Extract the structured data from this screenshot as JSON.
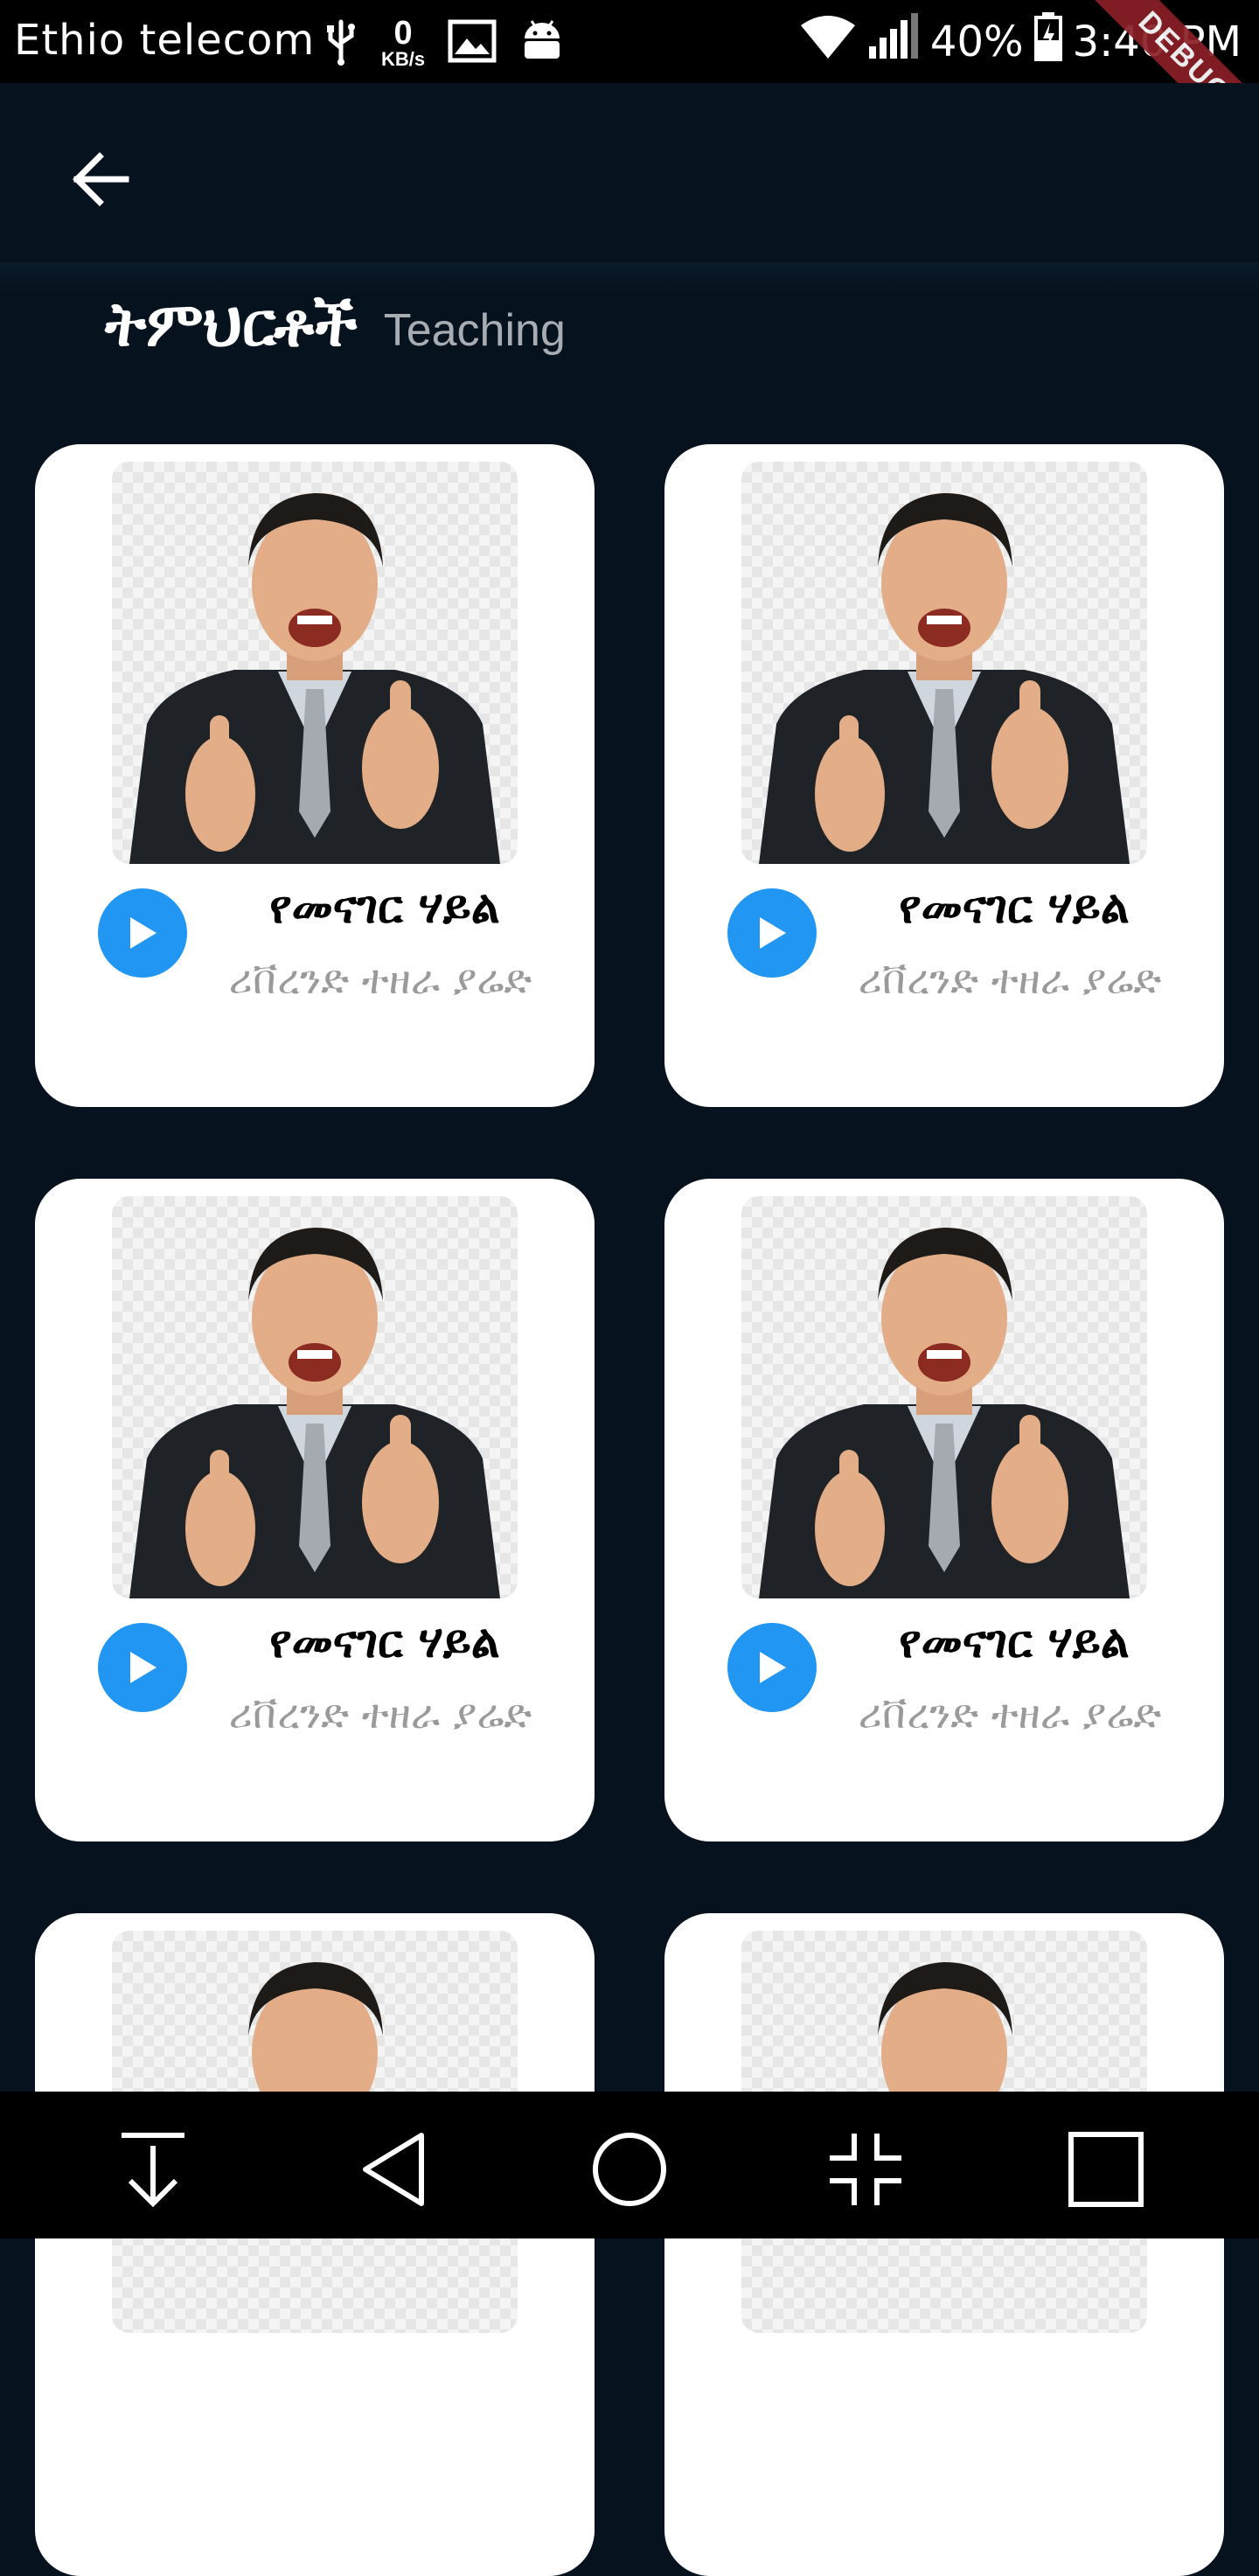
{
  "status_bar": {
    "carrier": "Ethio telecom",
    "kb_value": "0",
    "kb_unit": "KB/s",
    "battery": "40%",
    "time": "3:40 PM",
    "debug_label": "DEBUG"
  },
  "header": {
    "title_amharic": "ትምህርቶች",
    "title_english": "Teaching"
  },
  "cards": [
    {
      "title": "የመናገር ሃይል",
      "subtitle": "ሪቨረንድ ተዘራ ያሬድ"
    },
    {
      "title": "የመናገር ሃይል",
      "subtitle": "ሪቨረንድ ተዘራ ያሬድ"
    },
    {
      "title": "የመናገር ሃይል",
      "subtitle": "ሪቨረንድ ተዘራ ያሬድ"
    },
    {
      "title": "የመናገር ሃይል",
      "subtitle": "ሪቨረንድ ተዘራ ያሬድ"
    },
    {
      "title": "",
      "subtitle": ""
    },
    {
      "title": "",
      "subtitle": ""
    }
  ],
  "colors": {
    "background": "#06121d",
    "card": "#ffffff",
    "play_button": "#2196f3",
    "debug_ribbon": "#8b1f27"
  },
  "icons": {
    "back": "arrow-left-icon",
    "play": "play-icon",
    "nav": [
      "download-icon",
      "back-triangle-icon",
      "home-circle-icon",
      "collapse-icon",
      "recents-square-icon"
    ]
  }
}
